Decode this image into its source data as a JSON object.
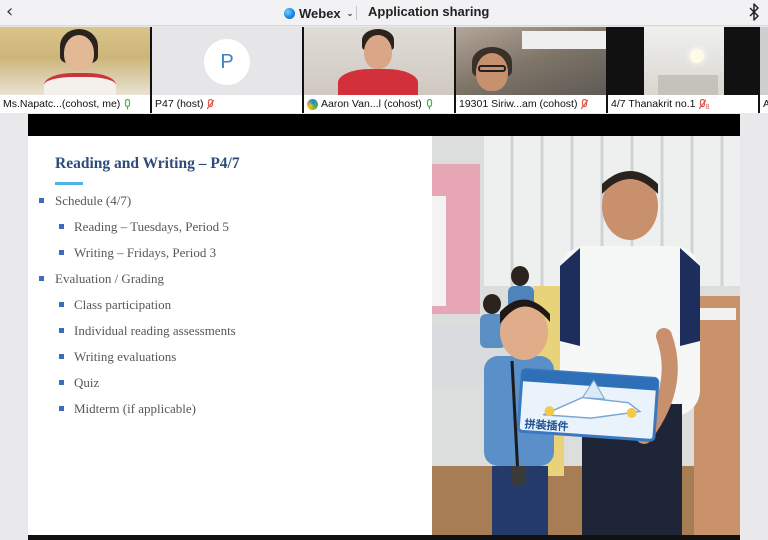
{
  "topbar": {
    "back_glyph": "‹",
    "app_name": "Webex",
    "app_menu_chevron": "⌄",
    "share_label": "Application sharing",
    "icons": [
      "back-chevron-icon",
      "webex-logo-icon",
      "chevron-down-icon",
      "bluetooth-icon"
    ]
  },
  "participants": [
    {
      "name": "Ms.Napatc...(cohost, me)",
      "mic": "unmuted",
      "mic_color": "#4caf50"
    },
    {
      "name": "P47 (host)",
      "avatar_initial": "P",
      "mic": "muted",
      "mic_color": "#e0564c"
    },
    {
      "name": "Aaron Van...l (cohost)",
      "mic": "unmuted",
      "mic_color": "#4caf50"
    },
    {
      "name": "19301 Siriw...am (cohost)",
      "mic": "muted",
      "mic_color": "#e0564c"
    },
    {
      "name": "4/7 Thanakrit no.1",
      "mic": "muted",
      "mic_color": "#e0564c",
      "mic_sub": "8"
    },
    {
      "name": "A"
    }
  ],
  "slide": {
    "title": "Reading and Writing – P4/7",
    "items": [
      {
        "text": "Schedule (4/7)",
        "level": 1
      },
      {
        "text": "Reading – Tuesdays, Period 5",
        "level": 2
      },
      {
        "text": "Writing – Fridays, Period 3",
        "level": 2
      },
      {
        "text": "Evaluation / Grading",
        "level": 1
      },
      {
        "text": "Class participation",
        "level": 2
      },
      {
        "text": "Individual reading assessments",
        "level": 2
      },
      {
        "text": "Writing evaluations",
        "level": 2
      },
      {
        "text": "Quiz",
        "level": 2
      },
      {
        "text": "Midterm (if applicable)",
        "level": 2
      }
    ],
    "accent_color": "#4fb4e4",
    "title_color": "#2e4b7a",
    "bullet_color": "#3a6cbf"
  },
  "photo": {
    "box_text": "拼装插件"
  }
}
